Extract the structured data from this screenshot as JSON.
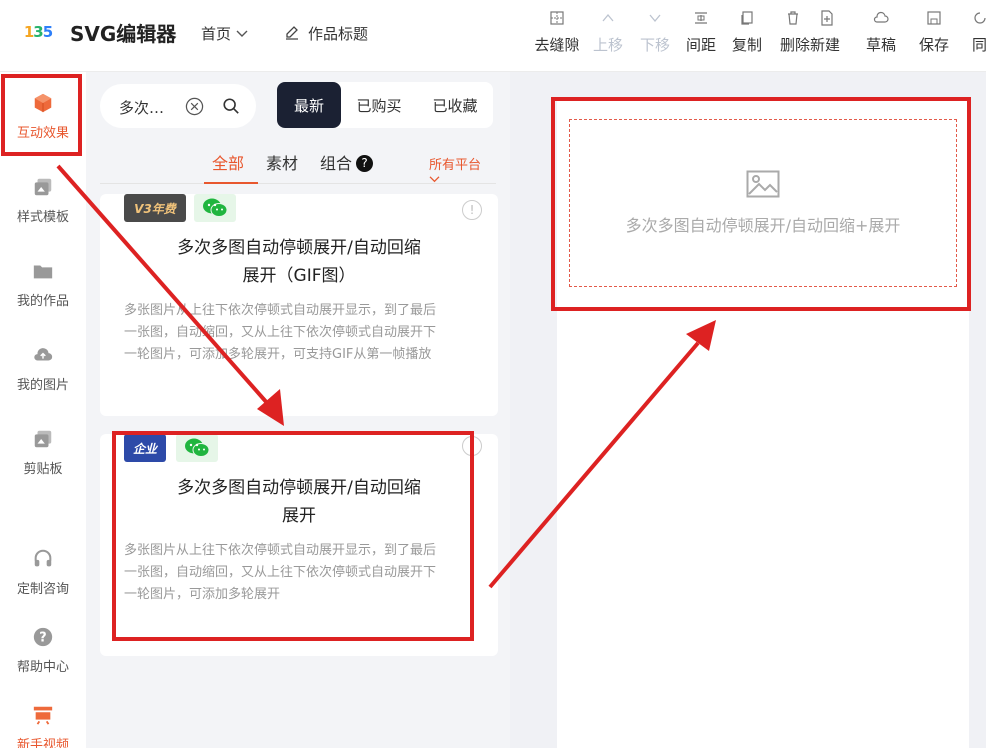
{
  "header": {
    "logo_text": [
      "1",
      "3",
      "5"
    ],
    "brand": "SVG编辑器",
    "home_nav": "首页",
    "title_nav": "作品标题",
    "tools": [
      {
        "label": "去缝隙",
        "icon": "grid-icon",
        "disabled": false
      },
      {
        "label": "上移",
        "icon": "chevron-up-icon",
        "disabled": true
      },
      {
        "label": "下移",
        "icon": "chevron-down-icon",
        "disabled": true
      },
      {
        "label": "间距",
        "icon": "spacing-icon",
        "disabled": false
      },
      {
        "label": "复制",
        "icon": "copy-icon",
        "disabled": false
      },
      {
        "label": "删除新建",
        "icon": "trash-icon",
        "disabled": false
      },
      {
        "label": "草稿",
        "icon": "cloud-icon",
        "disabled": false
      },
      {
        "label": "保存",
        "icon": "save-icon",
        "disabled": false
      },
      {
        "label": "同",
        "icon": "sync-icon",
        "disabled": false
      }
    ]
  },
  "sidebar": {
    "items": [
      {
        "label": "互动效果",
        "icon": "cube-icon"
      },
      {
        "label": "样式模板",
        "icon": "template-icon"
      },
      {
        "label": "我的作品",
        "icon": "folder-icon"
      },
      {
        "label": "我的图片",
        "icon": "cloud-upload-icon"
      },
      {
        "label": "剪贴板",
        "icon": "clipboard-icon"
      },
      {
        "label": "定制咨询",
        "icon": "headset-icon"
      },
      {
        "label": "帮助中心",
        "icon": "help-icon"
      },
      {
        "label": "新手视频",
        "icon": "video-icon"
      }
    ]
  },
  "panel": {
    "search_value": "多次…",
    "segments": [
      "最新",
      "已购买",
      "已收藏"
    ],
    "tabs": [
      "全部",
      "素材",
      "组合"
    ],
    "help_badge": "?",
    "platform": "所有平台",
    "cards": [
      {
        "badge1": "V3年费",
        "title_line1": "多次多图自动停顿展开/自动回缩",
        "title_line2": "展开（GIF图）",
        "desc": [
          "多张图片从上往下依次停顿式自动展开显示，到了最后",
          "一张图，自动缩回，又从上往下依次停顿式自动展开下",
          "一轮图片，可添加多轮展开，可支持GIF从第一帧播放"
        ]
      },
      {
        "badge1": "企业",
        "title_line1": "多次多图自动停顿展开/自动回缩",
        "title_line2": "展开",
        "desc": [
          "多张图片从上往下依次停顿式自动展开显示，到了最后",
          "一张图，自动缩回，又从上往下依次停顿式自动展开下",
          "一轮图片，可添加多轮展开"
        ]
      }
    ]
  },
  "canvas": {
    "placeholder_text": "多次多图自动停顿展开/自动回缩+展开"
  },
  "colors": {
    "accent": "#e8572e",
    "annotation": "#dd2222",
    "dark_button": "#1b2133"
  }
}
